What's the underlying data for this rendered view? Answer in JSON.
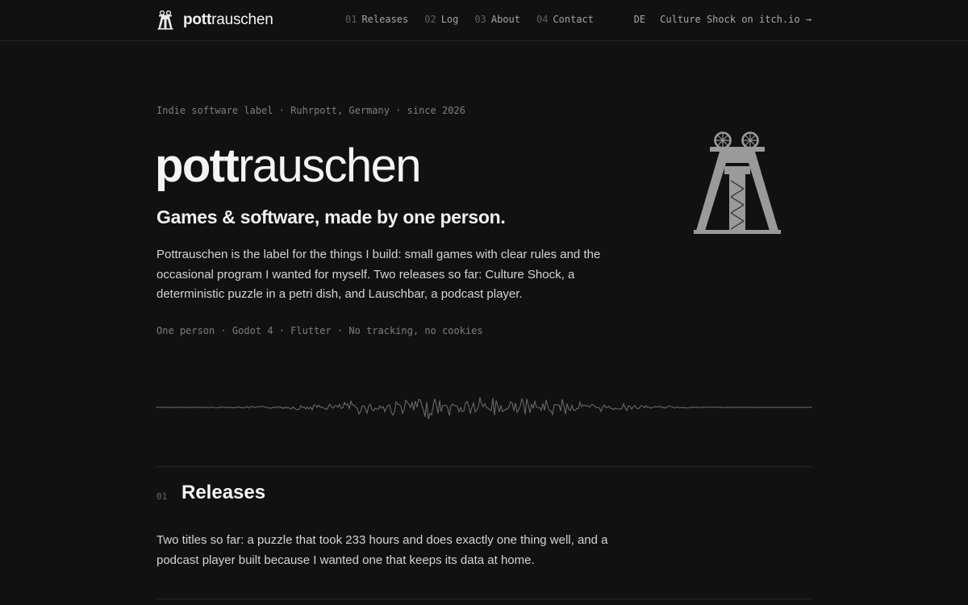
{
  "header": {
    "brand_bold": "pott",
    "brand_rest": "rauschen",
    "nav": [
      {
        "num": "01",
        "label": "Releases"
      },
      {
        "num": "02",
        "label": "Log"
      },
      {
        "num": "03",
        "label": "About"
      },
      {
        "num": "04",
        "label": "Contact"
      }
    ],
    "lang": "DE",
    "cta": "Culture Shock on itch.io →"
  },
  "hero": {
    "meta": "Indie software label · Ruhrpott, Germany · since 2026",
    "title_bold": "pott",
    "title_rest": "rauschen",
    "tagline": "Games & software, made by one person.",
    "intro": "Pottrauschen is the label for the things I build: small games with clear rules and the occasional program I wanted for myself. Two releases so far: Culture Shock, a deterministic puzzle in a petri dish, and Lauschbar, a podcast player.",
    "stack": "One person · Godot 4 · Flutter · No tracking, no cookies"
  },
  "releases": {
    "num": "01",
    "title": "Releases",
    "text": "Two titles so far: a puzzle that took 233 hours and does exactly one thing well, and a podcast player built because I wanted one that keeps its data at home."
  },
  "icons": {
    "brand": "mine-headframe-icon",
    "hero": "mine-headframe-illustration"
  },
  "colors": {
    "background": "#111112",
    "text": "#e6e6e6",
    "muted": "#7e7e80",
    "tower": "#9a9a9a"
  }
}
